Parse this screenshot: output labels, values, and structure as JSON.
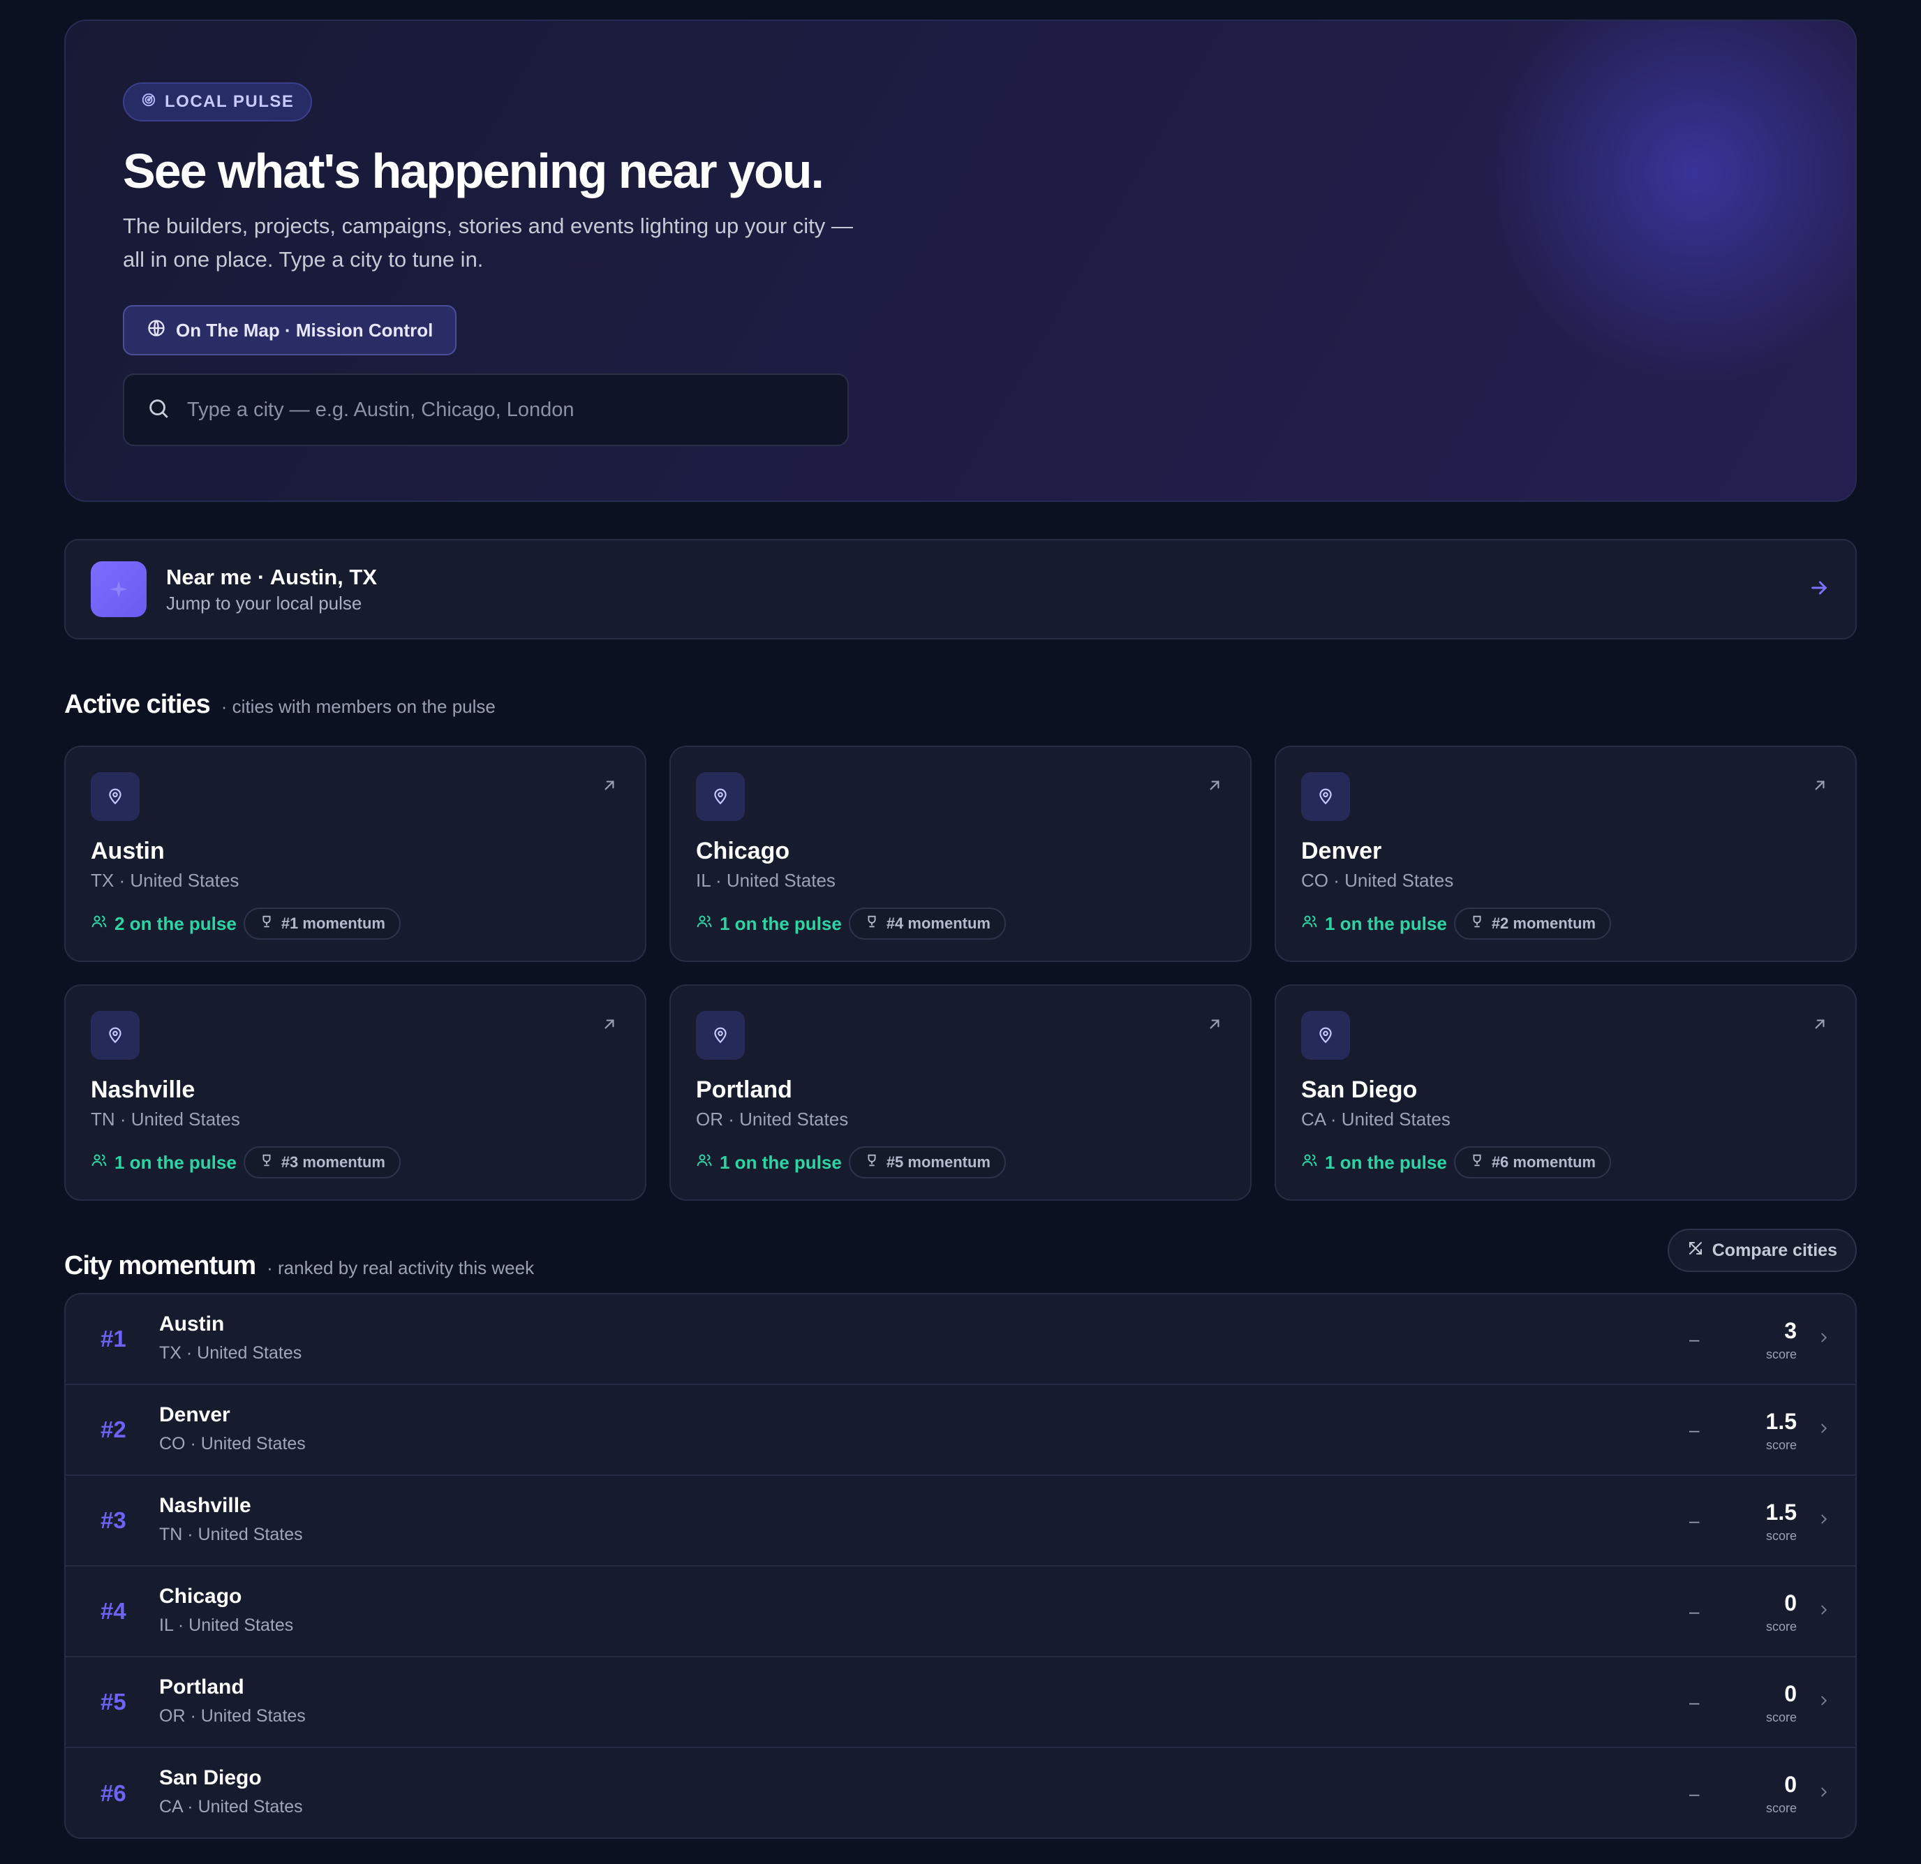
{
  "hero": {
    "badge": "LOCAL PULSE",
    "title": "See what's happening near you.",
    "subtitle_line1": "The builders, projects, campaigns, stories and events lighting up your city —",
    "subtitle_line2": "all in one place. Type a city to tune in.",
    "map_button": "On The Map · Mission Control",
    "search_placeholder": "Type a city — e.g. Austin, Chicago, London",
    "search_value": ""
  },
  "near_me": {
    "title": "Near me · Austin, TX",
    "subtitle": "Jump to your local pulse",
    "icon": "sparkle-icon"
  },
  "active_cities": {
    "heading": "Active cities",
    "subheading": "· cities with members on the pulse",
    "cards": [
      {
        "name": "Austin",
        "location": "TX · United States",
        "pulse": "2 on the pulse",
        "momentum": "#1 momentum"
      },
      {
        "name": "Chicago",
        "location": "IL · United States",
        "pulse": "1 on the pulse",
        "momentum": "#4 momentum"
      },
      {
        "name": "Denver",
        "location": "CO · United States",
        "pulse": "1 on the pulse",
        "momentum": "#2 momentum"
      },
      {
        "name": "Nashville",
        "location": "TN · United States",
        "pulse": "1 on the pulse",
        "momentum": "#3 momentum"
      },
      {
        "name": "Portland",
        "location": "OR · United States",
        "pulse": "1 on the pulse",
        "momentum": "#5 momentum"
      },
      {
        "name": "San Diego",
        "location": "CA · United States",
        "pulse": "1 on the pulse",
        "momentum": "#6 momentum"
      }
    ]
  },
  "momentum": {
    "heading": "City momentum",
    "subheading": "· ranked by real activity this week",
    "compare_button": "Compare cities",
    "score_label": "score",
    "rows": [
      {
        "rank": "#1",
        "name": "Austin",
        "location": "TX · United States",
        "trend": "–",
        "score": "3"
      },
      {
        "rank": "#2",
        "name": "Denver",
        "location": "CO · United States",
        "trend": "–",
        "score": "1.5"
      },
      {
        "rank": "#3",
        "name": "Nashville",
        "location": "TN · United States",
        "trend": "–",
        "score": "1.5"
      },
      {
        "rank": "#4",
        "name": "Chicago",
        "location": "IL · United States",
        "trend": "–",
        "score": "0"
      },
      {
        "rank": "#5",
        "name": "Portland",
        "location": "OR · United States",
        "trend": "–",
        "score": "0"
      },
      {
        "rank": "#6",
        "name": "San Diego",
        "location": "CA · United States",
        "trend": "–",
        "score": "0"
      }
    ]
  },
  "colors": {
    "background": "#0b1120",
    "card": "#161c2e",
    "accent": "#6d64f7",
    "pulse_green": "#2dd4a4"
  }
}
